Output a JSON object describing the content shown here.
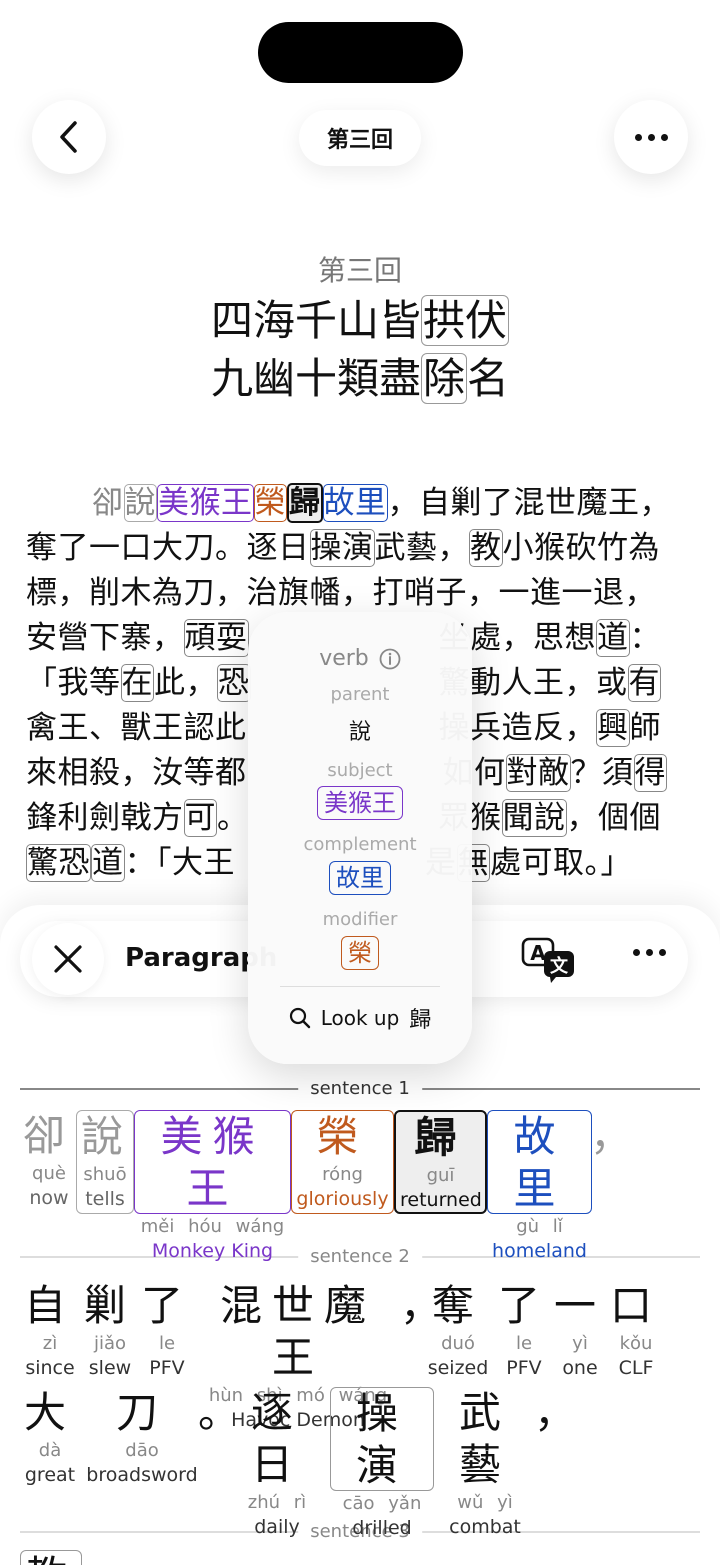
{
  "header": {
    "title": "第三回"
  },
  "reader": {
    "chapter_number": "第三回",
    "title_line_1_a": "四海千山皆",
    "title_line_1_b": "拱伏",
    "title_line_2_a": "九幽十類盡",
    "title_line_2_b": "除",
    "title_line_2_c": "名",
    "p_line_1": [
      "卻",
      "說",
      "美猴王",
      "榮",
      "歸",
      "故里",
      "，自剿了混世魔王，"
    ],
    "p_line_2": [
      "奪了一口大刀。逐日",
      "操演",
      "武藝，",
      "教",
      "小猴砍竹為"
    ],
    "p_line_3": "標，削木為刀，治旗幡，打哨子，一進一退，",
    "p_line_4_a": "安營下寨，",
    "p_line_4_b": "頑耍",
    "p_line_4_c": "坐處，思想",
    "p_line_4_d": "道",
    "p_line_4_e": "：",
    "p_line_5_a": "「我等",
    "p_line_5_b": "在",
    "p_line_5_c": "此，",
    "p_line_5_d": "恐",
    "p_line_5_e": "驚動人王，或",
    "p_line_5_f": "有",
    "p_line_6_a": "禽王、獸王認此",
    "p_line_6_b": "操兵造反，",
    "p_line_6_c": "興",
    "p_line_6_d": "師",
    "p_line_7_a": "來相殺，汝等都",
    "p_line_7_b": "如何",
    "p_line_7_c": "對敵",
    "p_line_7_d": "？須",
    "p_line_7_e": "得",
    "p_line_8_a": "鋒利劍戟方",
    "p_line_8_b": "可",
    "p_line_8_c": "。",
    "p_line_8_d": "眾猴",
    "p_line_8_e": "聞說",
    "p_line_8_f": "，個個",
    "p_line_9_a": "驚恐",
    "p_line_9_b": "道",
    "p_line_9_c": "：「大王",
    "p_line_9_d": "是",
    "p_line_9_e": "無",
    "p_line_9_f": "處可取。」"
  },
  "popup": {
    "pos": "verb",
    "parent_label": "parent",
    "parent_value": "說",
    "subject_label": "subject",
    "subject_value": "美猴王",
    "complement_label": "complement",
    "complement_value": "故里",
    "modifier_label": "modifier",
    "modifier_value": "榮",
    "lookup_label": "Look up",
    "lookup_char": "歸"
  },
  "sheet": {
    "title": "Paragraph",
    "sentence_1_label": "sentence 1",
    "sentence_2_label": "sentence 2",
    "sentence_3_label": "sentence 3",
    "s1": [
      {
        "hz": "卻",
        "py": "què",
        "gl": "now",
        "color": "#999999"
      },
      {
        "hz": "說",
        "py": "shuō",
        "gl": "tells",
        "color": "#999999"
      },
      {
        "hz": "美猴王",
        "py": "měi hóu wáng",
        "gl": "Monkey King",
        "color": "#7a36c9"
      },
      {
        "hz": "榮",
        "py": "róng",
        "gl": "gloriously",
        "color": "#c05a1e"
      },
      {
        "hz": "歸",
        "py": "guī",
        "gl": "returned",
        "color": "#111111"
      },
      {
        "hz": "故里",
        "py": "gù lǐ",
        "gl": "homeland",
        "color": "#1d4fbe"
      },
      {
        "hz": "，",
        "py": "",
        "gl": "",
        "color": "#999999"
      }
    ],
    "s2_row1": [
      {
        "hz": "自",
        "py": "zì",
        "gl": "since"
      },
      {
        "hz": "剿",
        "py": "jiǎo",
        "gl": "slew"
      },
      {
        "hz": "了",
        "py": "le",
        "gl": "PFV"
      },
      {
        "hz": "混世魔王",
        "py": "hùn shì mó wáng",
        "gl": "Havoc Demon"
      },
      {
        "hz": "，",
        "py": "",
        "gl": ""
      },
      {
        "hz": "奪",
        "py": "duó",
        "gl": "seized"
      },
      {
        "hz": "了",
        "py": "le",
        "gl": "PFV"
      },
      {
        "hz": "一",
        "py": "yì",
        "gl": "one"
      },
      {
        "hz": "口",
        "py": "kǒu",
        "gl": "CLF"
      }
    ],
    "s2_row2": [
      {
        "hz": "大",
        "py": "dà",
        "gl": "great"
      },
      {
        "hz": "刀",
        "py": "dāo",
        "gl": "broadsword"
      },
      {
        "hz": "。",
        "py": "",
        "gl": ""
      },
      {
        "hz": "逐日",
        "py": "zhú rì",
        "gl": "daily"
      },
      {
        "hz": "操演",
        "py": "cāo yǎn",
        "gl": "drilled"
      },
      {
        "hz": "武藝",
        "py": "wǔ yì",
        "gl": "combat"
      },
      {
        "hz": "，",
        "py": "",
        "gl": ""
      }
    ],
    "s3_first": "教"
  }
}
